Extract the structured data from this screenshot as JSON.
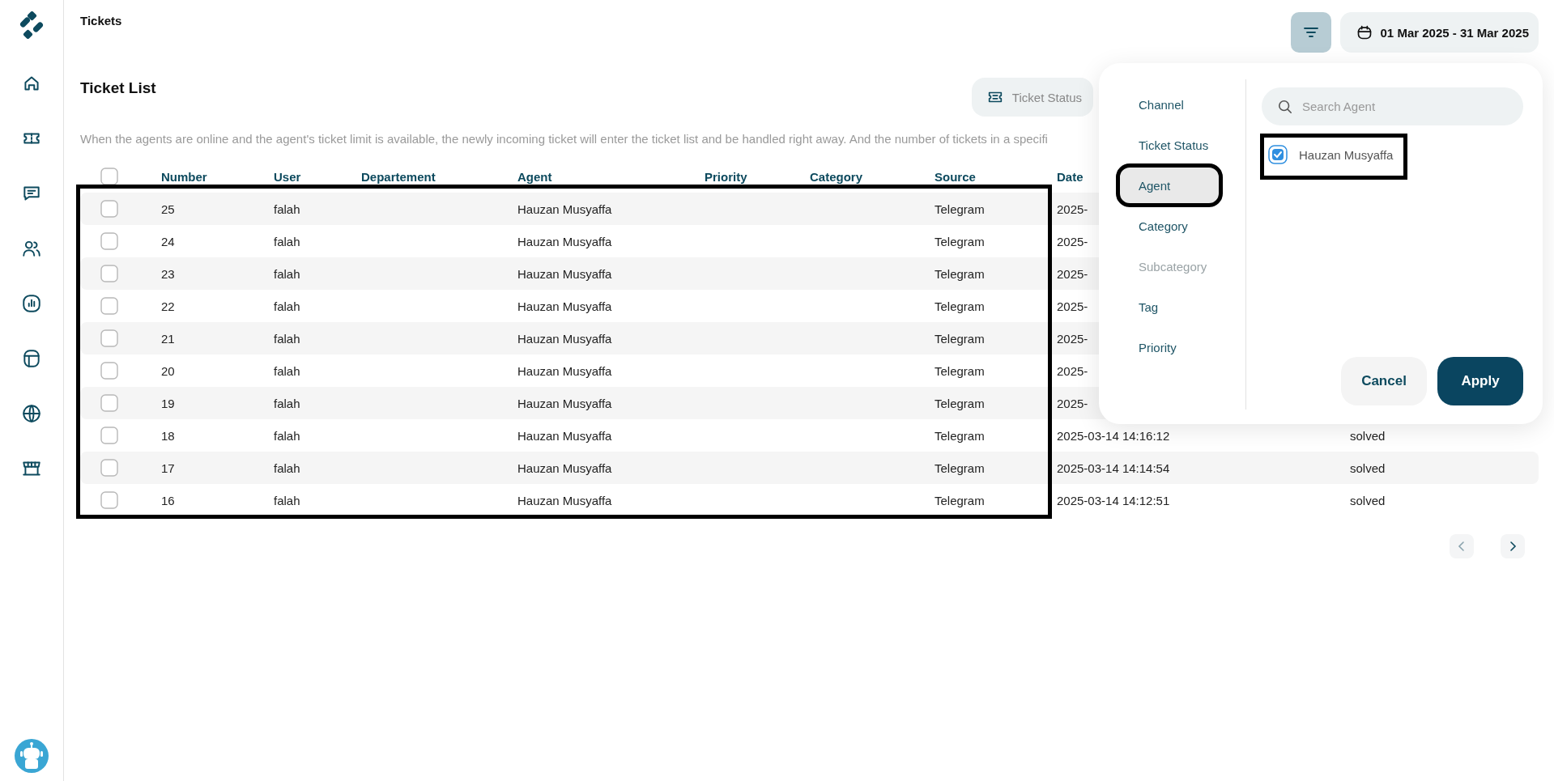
{
  "header": {
    "title": "Tickets",
    "filter_active": true,
    "date_range": "01 Mar 2025 - 31 Mar 2025"
  },
  "ticket_list": {
    "title": "Ticket List",
    "status_button": "Ticket Status",
    "description": "When the agents are online and the agent's ticket limit is available, the newly incoming ticket will enter the ticket list and be handled right away. And the number of tickets in a specifi"
  },
  "table": {
    "highlighted": true,
    "select_all_checked": false,
    "columns": [
      "Number",
      "User",
      "Departement",
      "Agent",
      "Priority",
      "Category",
      "Source",
      "Date"
    ],
    "rows": [
      {
        "checked": false,
        "number": "25",
        "user": "falah",
        "agent": "Hauzan Musyaffa",
        "source": "Telegram",
        "date": "2025-"
      },
      {
        "checked": false,
        "number": "24",
        "user": "falah",
        "agent": "Hauzan Musyaffa",
        "source": "Telegram",
        "date": "2025-"
      },
      {
        "checked": false,
        "number": "23",
        "user": "falah",
        "agent": "Hauzan Musyaffa",
        "source": "Telegram",
        "date": "2025-"
      },
      {
        "checked": false,
        "number": "22",
        "user": "falah",
        "agent": "Hauzan Musyaffa",
        "source": "Telegram",
        "date": "2025-"
      },
      {
        "checked": false,
        "number": "21",
        "user": "falah",
        "agent": "Hauzan Musyaffa",
        "source": "Telegram",
        "date": "2025-"
      },
      {
        "checked": false,
        "number": "20",
        "user": "falah",
        "agent": "Hauzan Musyaffa",
        "source": "Telegram",
        "date": "2025-"
      },
      {
        "checked": false,
        "number": "19",
        "user": "falah",
        "agent": "Hauzan Musyaffa",
        "source": "Telegram",
        "date": "2025-"
      },
      {
        "checked": false,
        "number": "18",
        "user": "falah",
        "agent": "Hauzan Musyaffa",
        "source": "Telegram",
        "date": "2025-03-14 14:16:12",
        "status": "solved"
      },
      {
        "checked": false,
        "number": "17",
        "user": "falah",
        "agent": "Hauzan Musyaffa",
        "source": "Telegram",
        "date": "2025-03-14 14:14:54",
        "status": "solved"
      },
      {
        "checked": false,
        "number": "16",
        "user": "falah",
        "agent": "Hauzan Musyaffa",
        "source": "Telegram",
        "date": "2025-03-14 14:12:51",
        "status": "solved"
      }
    ]
  },
  "pagination": {
    "prev_disabled": true,
    "next_disabled": false
  },
  "filter_popup": {
    "categories": [
      {
        "label": "Channel",
        "selected": false,
        "disabled": false,
        "highlighted": false
      },
      {
        "label": "Ticket Status",
        "selected": false,
        "disabled": false,
        "highlighted": false
      },
      {
        "label": "Agent",
        "selected": true,
        "disabled": false,
        "highlighted": true
      },
      {
        "label": "Category",
        "selected": false,
        "disabled": false,
        "highlighted": false
      },
      {
        "label": "Subcategory",
        "selected": false,
        "disabled": true,
        "highlighted": false
      },
      {
        "label": "Tag",
        "selected": false,
        "disabled": false,
        "highlighted": false
      },
      {
        "label": "Priority",
        "selected": false,
        "disabled": false,
        "highlighted": false
      }
    ],
    "search": {
      "placeholder": "Search Agent"
    },
    "options": [
      {
        "label": "Hauzan Musyaffa",
        "checked": true,
        "highlighted": true
      }
    ],
    "buttons": [
      {
        "label": "Cancel",
        "kind": "secondary"
      },
      {
        "label": "Apply",
        "kind": "primary"
      }
    ]
  }
}
